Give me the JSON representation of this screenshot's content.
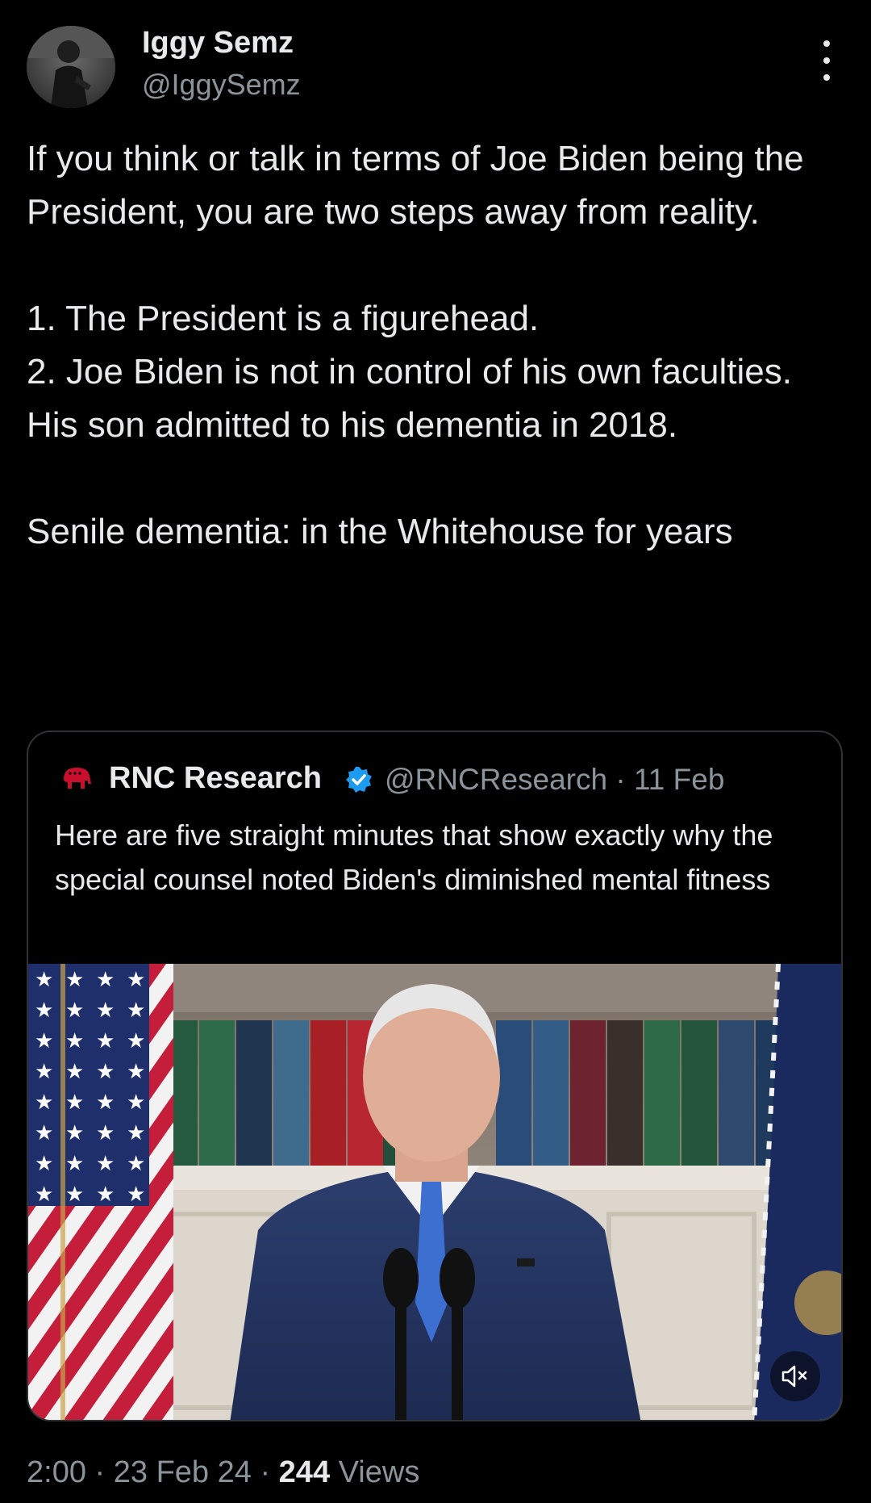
{
  "author": {
    "display_name": "Iggy Semz",
    "handle": "@IggySemz",
    "avatar_icon": "user-avatar-photo"
  },
  "more_icon": "more-vertical-icon",
  "tweet": {
    "text": "If you think or talk in terms of Joe Biden being the President, you are two steps away from reality.\n\n1. The President is a figurehead.\n2. Joe Biden is not in control of his own faculties. His son admitted to his dementia in 2018.\n\nSenile dementia: in the Whitehouse for years"
  },
  "quoted_tweet": {
    "logo_icon": "rnc-elephant-icon",
    "name": "RNC Research",
    "verified_icon": "verified-badge-icon",
    "handle": "@RNCResearch",
    "separator": "·",
    "date": "11 Feb",
    "text": "Here are five straight minutes that show exactly why the special counsel noted Biden's diminished mental fitness",
    "media": {
      "type": "video",
      "mute_icon": "speaker-muted-icon"
    }
  },
  "meta": {
    "time": "2:00",
    "date": "23 Feb 24",
    "separator": "·",
    "views_count": "244",
    "views_label": "Views"
  },
  "colors": {
    "background": "#000000",
    "text_primary": "#e7e9ea",
    "text_secondary": "#8b949a",
    "border": "#2f3336",
    "verified": "#1d9bf0",
    "rnc_red": "#c8102e"
  }
}
